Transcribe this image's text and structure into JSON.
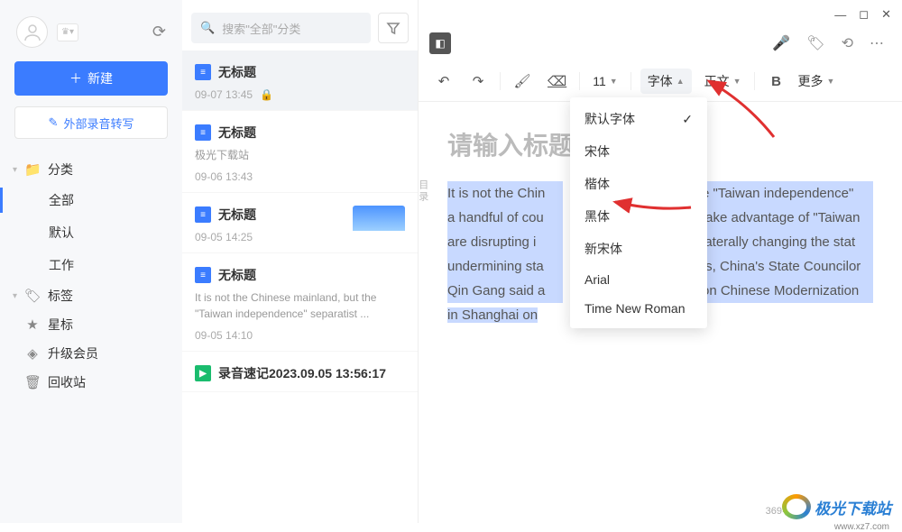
{
  "sidebar": {
    "new_label": "新建",
    "external_audio_label": "外部录音转写",
    "categories_label": "分类",
    "cat_all": "全部",
    "cat_default": "默认",
    "cat_work": "工作",
    "tags_label": "标签",
    "starred_label": "星标",
    "upgrade_label": "升级会员",
    "trash_label": "回收站"
  },
  "search": {
    "placeholder": "搜索\"全部\"分类"
  },
  "notes": [
    {
      "title": "无标题",
      "date": "09-07 13:45",
      "locked": true
    },
    {
      "title": "无标题",
      "subtitle": "极光下载站",
      "date": "09-06 13:43"
    },
    {
      "title": "无标题",
      "date": "09-05 14:25",
      "thumb": true
    },
    {
      "title": "无标题",
      "preview": "It is not the Chinese mainland, but the \"Taiwan independence\" separatist ...",
      "date": "09-05 14:10"
    },
    {
      "title": "录音速记2023.09.05 13:56:17",
      "audio": true
    }
  ],
  "editor": {
    "font_size": "11",
    "font_label": "字体",
    "paragraph_label": "正文",
    "more_label": "更多",
    "title_placeholder": "请输入标题",
    "body_text": "It is not the Chinese mainland, but the \"Taiwan independence\" separatist forces and a handful of countries that try to take advantage of \"Taiwan independence\" that are disrupting international order and unilaterally changing the status quo and undermining stability across the Taiwan Straits, China's State Councilor and Foreign Minister Qin Gang said at the Lanting Forum on Chinese Modernization and the World which was held in Shanghai on Monday.",
    "toc_label": "目录",
    "word_count": "369字"
  },
  "font_dropdown": {
    "items": [
      "默认字体",
      "宋体",
      "楷体",
      "黑体",
      "新宋体",
      "Arial",
      "Time New Roman"
    ],
    "selected_index": 0
  },
  "watermark": {
    "name": "极光下载站",
    "url": "www.xz7.com"
  }
}
